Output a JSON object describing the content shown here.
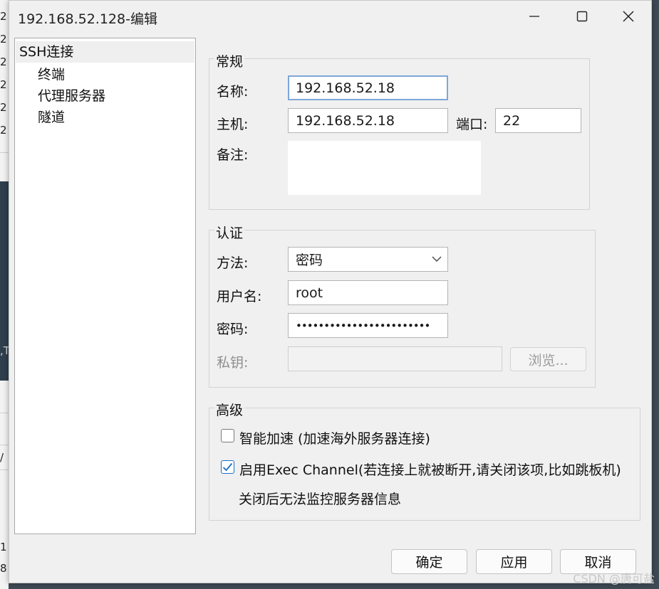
{
  "window": {
    "title": "192.168.52.128-编辑"
  },
  "background": {
    "left_fragments": [
      "2",
      "2",
      "2",
      "2",
      "2",
      "2",
      ",T",
      "/",
      "1",
      "8"
    ]
  },
  "sidebar": {
    "items": [
      {
        "label": "SSH连接",
        "selected": true
      },
      {
        "label": "终端"
      },
      {
        "label": "代理服务器"
      },
      {
        "label": "隧道"
      }
    ]
  },
  "general": {
    "title": "常规",
    "name_label": "名称:",
    "name_value": "192.168.52.18",
    "host_label": "主机:",
    "host_value": "192.168.52.18",
    "port_label": "端口:",
    "port_value": "22",
    "note_label": "备注:",
    "note_value": ""
  },
  "auth": {
    "title": "认证",
    "method_label": "方法:",
    "method_value": "密码",
    "user_label": "用户名:",
    "user_value": "root",
    "password_label": "密码:",
    "password_value": "••••••••••••••••••••••••",
    "key_label": "私钥:",
    "key_value": "",
    "browse_label": "浏览..."
  },
  "advanced": {
    "title": "高级",
    "smart_accel_label": "智能加速 (加速海外服务器连接)",
    "smart_accel_checked": false,
    "exec_channel_label": "启用Exec Channel(若连接上就被断开,请关闭该项,比如跳板机)",
    "exec_channel_checked": true,
    "exec_note": "关闭后无法监控服务器信息"
  },
  "buttons": {
    "ok": "确定",
    "apply": "应用",
    "cancel": "取消"
  },
  "watermark": "CSDN @唐可盐",
  "colors": {
    "accent": "#1b6fc5",
    "focus_border": "#7ea7d8",
    "dialog_bg": "#f0f0f0"
  }
}
